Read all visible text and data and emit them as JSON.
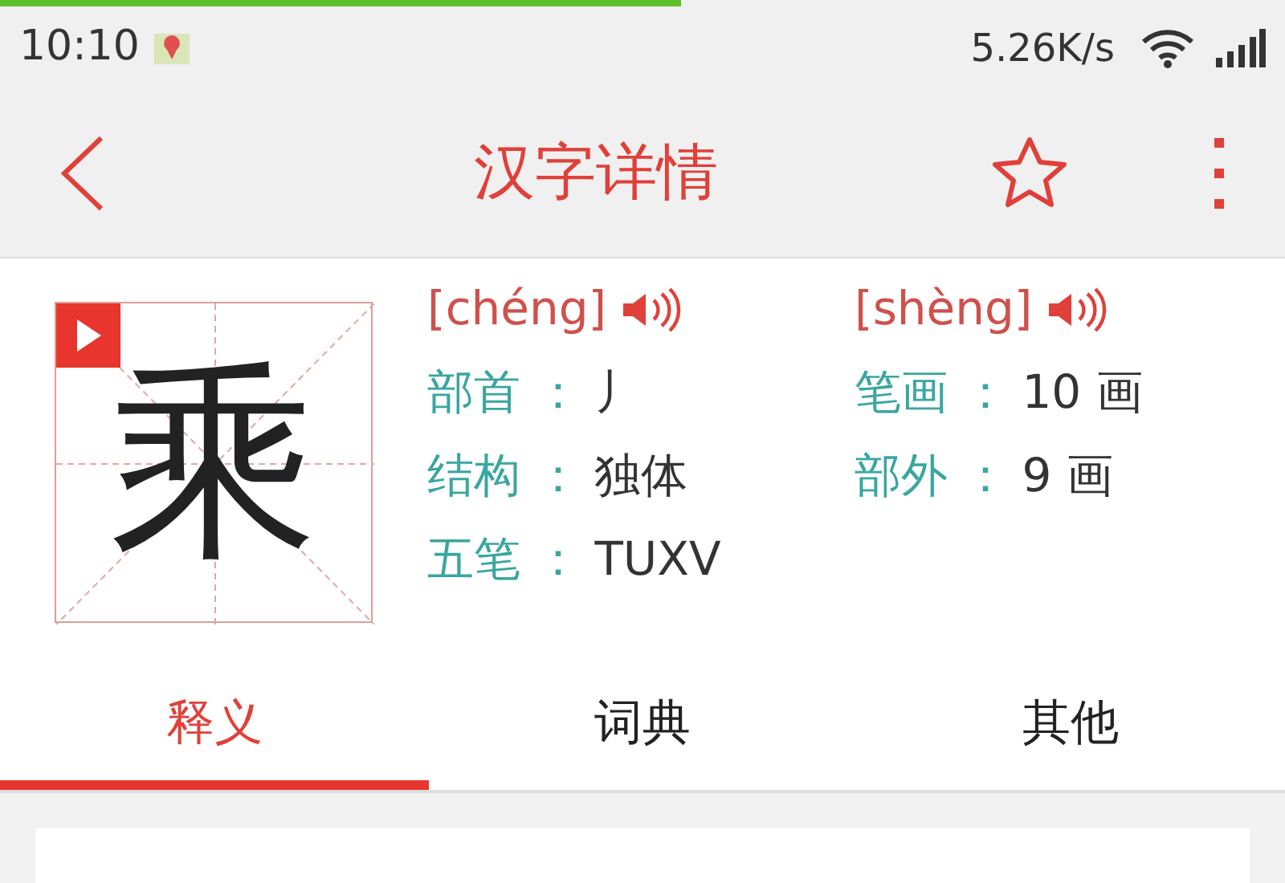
{
  "progress": {
    "level": 0.53
  },
  "status_bar": {
    "time": "10:10",
    "speed": "5.26K/s"
  },
  "header": {
    "title": "汉字详情",
    "favorited": false
  },
  "character": {
    "glyph": "乘"
  },
  "pronunciations": [
    {
      "pinyin": "[chéng]"
    },
    {
      "pinyin": "[shèng]"
    }
  ],
  "details": [
    [
      {
        "label": "部首 ：",
        "value": "丿"
      },
      {
        "label": "结构 ：",
        "value": "独体"
      },
      {
        "label": "五笔 ：",
        "value": "TUXV"
      }
    ],
    [
      {
        "label": "笔画 ：",
        "value": "10 画"
      },
      {
        "label": "部外 ：",
        "value": "9 画"
      }
    ]
  ],
  "tabs": [
    {
      "label": "释义",
      "selected": true
    },
    {
      "label": "词典",
      "selected": false
    },
    {
      "label": "其他",
      "selected": false
    }
  ]
}
